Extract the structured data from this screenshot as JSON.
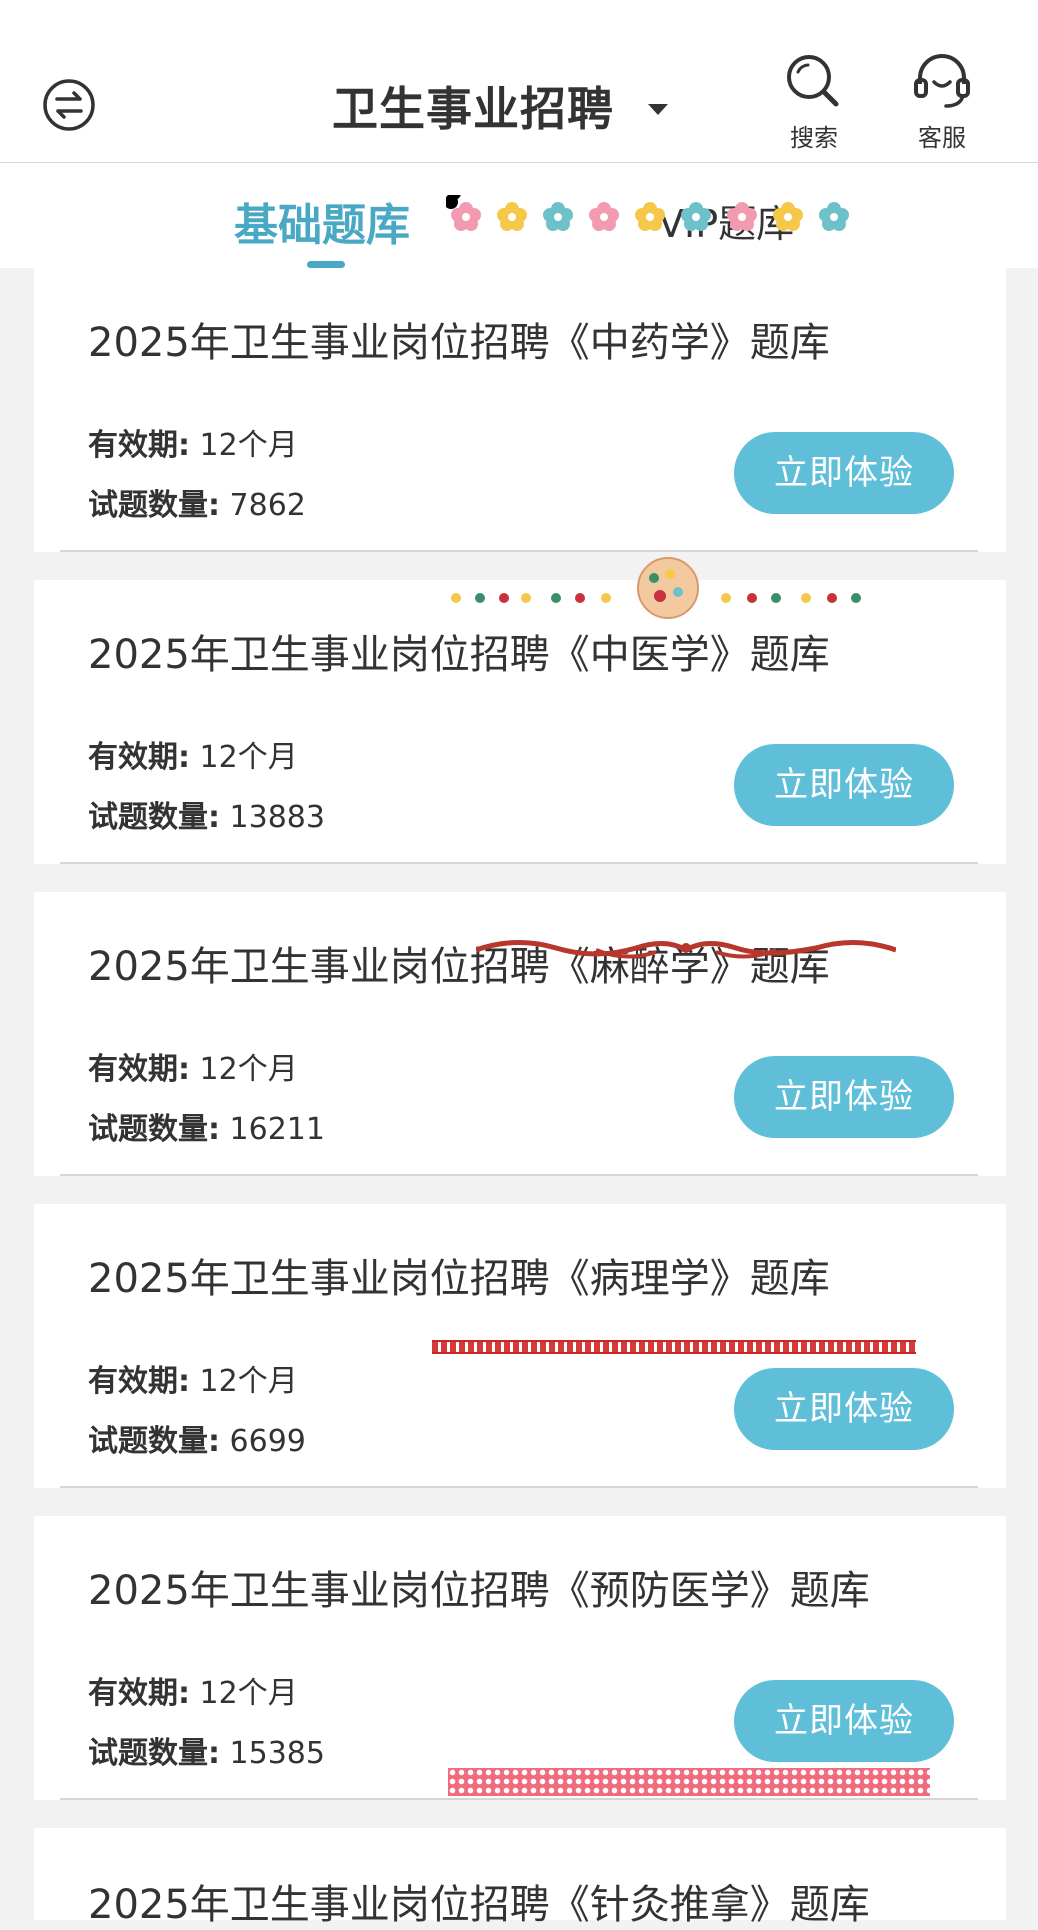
{
  "header": {
    "title": "卫生事业招聘",
    "search_label": "搜索",
    "service_label": "客服"
  },
  "tabs": {
    "basic_label": "基础题库",
    "vip_label": "VIP题库"
  },
  "cards": [
    {
      "title": "2025年卫生事业岗位招聘《中药学》题库",
      "validity_key": "有效期:",
      "validity_value": "12个月",
      "count_key": "试题数量:",
      "count_value": "7862",
      "button": "立即体验"
    },
    {
      "title": "2025年卫生事业岗位招聘《中医学》题库",
      "validity_key": "有效期:",
      "validity_value": "12个月",
      "count_key": "试题数量:",
      "count_value": "13883",
      "button": "立即体验"
    },
    {
      "title": "2025年卫生事业岗位招聘《麻醉学》题库",
      "validity_key": "有效期:",
      "validity_value": "12个月",
      "count_key": "试题数量:",
      "count_value": "16211",
      "button": "立即体验"
    },
    {
      "title": "2025年卫生事业岗位招聘《病理学》题库",
      "validity_key": "有效期:",
      "validity_value": "12个月",
      "count_key": "试题数量:",
      "count_value": "6699",
      "button": "立即体验"
    },
    {
      "title": "2025年卫生事业岗位招聘《预防医学》题库",
      "validity_key": "有效期:",
      "validity_value": "12个月",
      "count_key": "试题数量:",
      "count_value": "15385",
      "button": "立即体验"
    },
    {
      "title": "2025年卫生事业岗位招聘《针灸推拿》题库"
    }
  ],
  "icons": {
    "switch": "switch-arrows-icon",
    "search": "search-icon",
    "service": "headset-icon",
    "dropdown": "caret-down-icon"
  },
  "colors": {
    "accent": "#49a8c3",
    "button": "#5fbfd9",
    "background": "#f2f2f2"
  }
}
